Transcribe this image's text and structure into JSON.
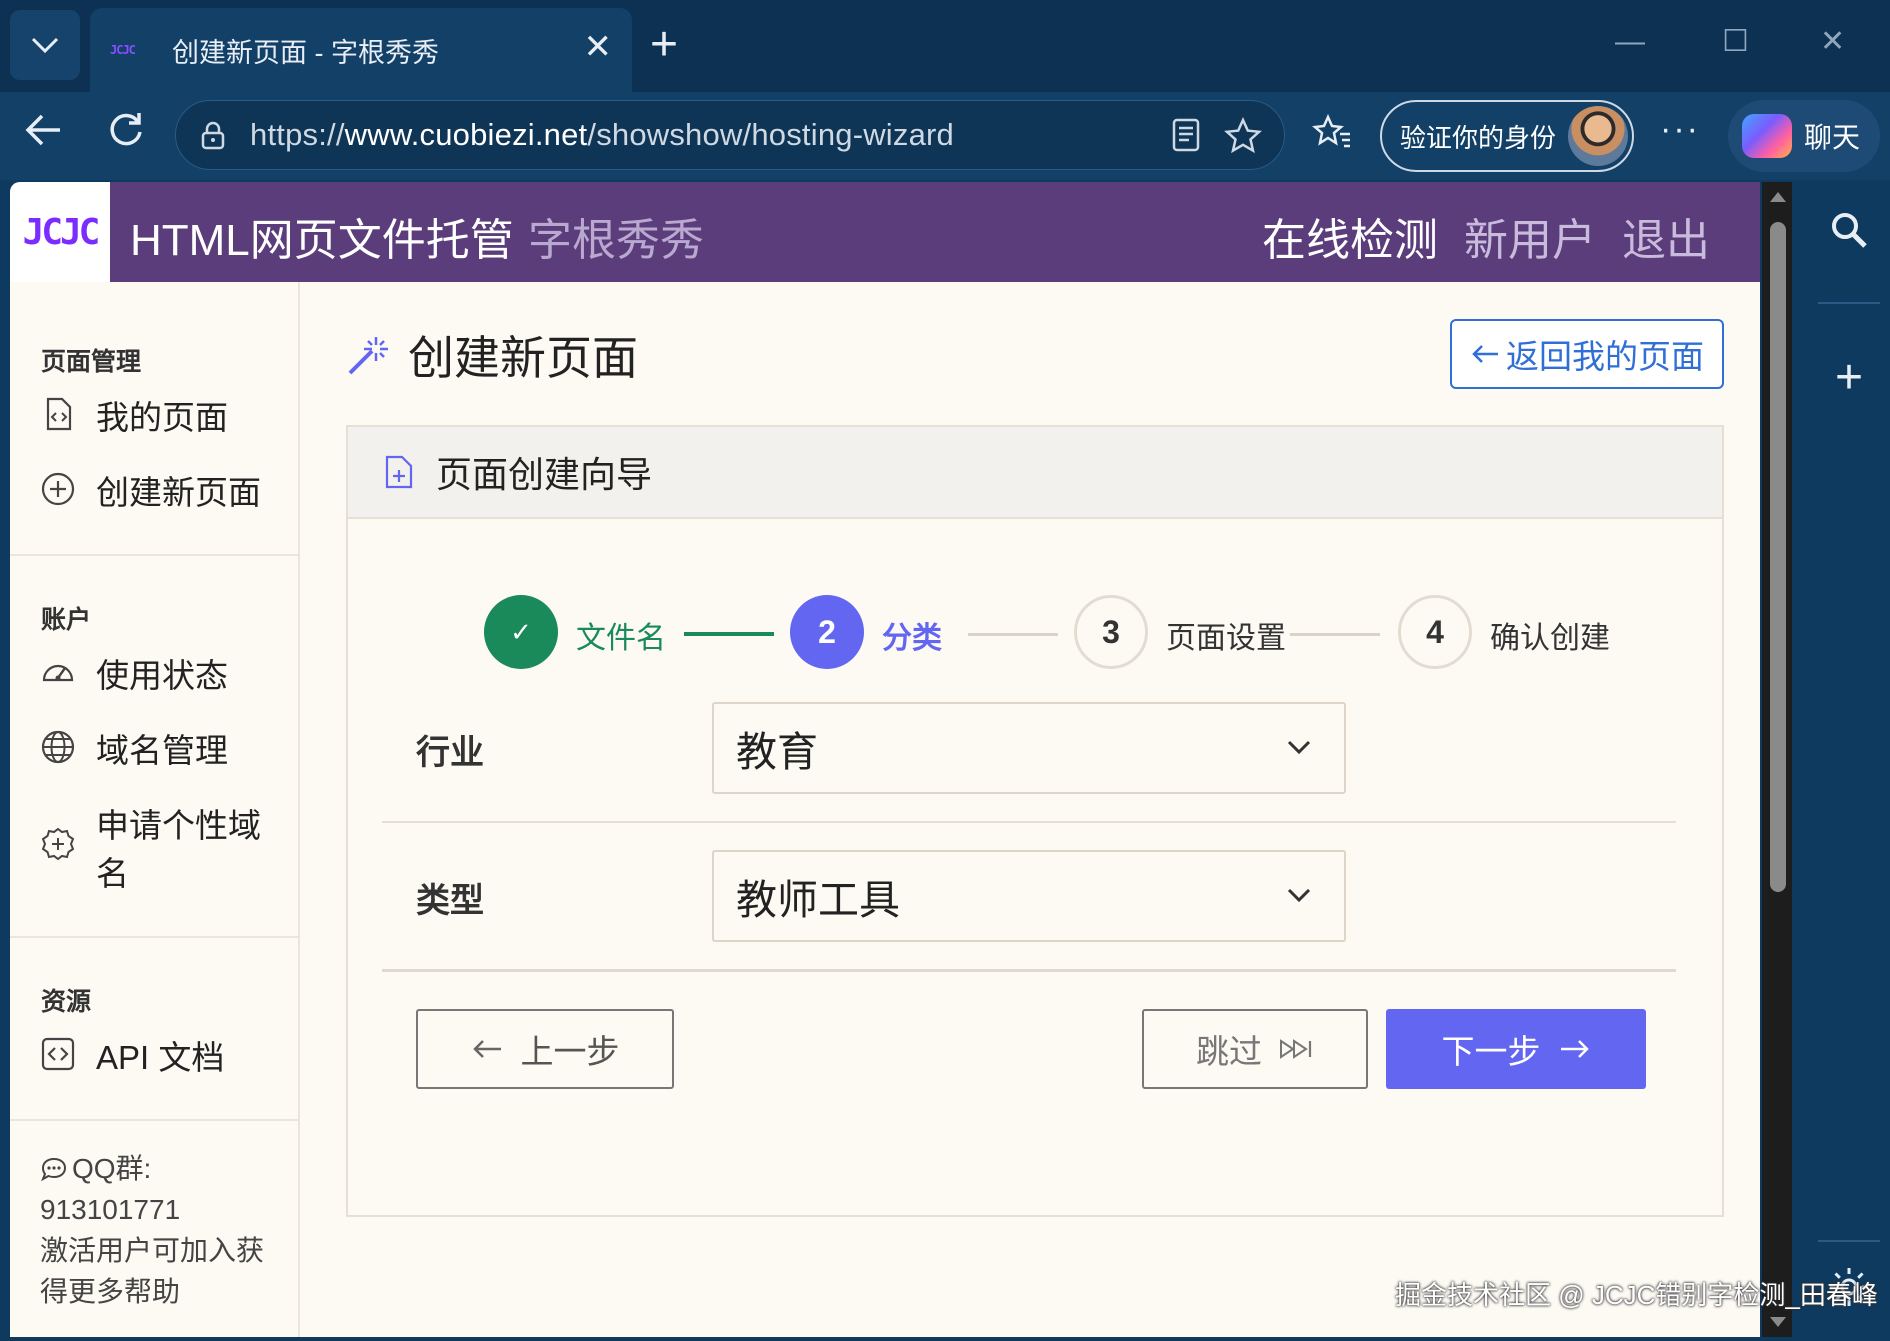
{
  "browser": {
    "tab_title": "创建新页面 - 字根秀秀",
    "tab_favicon": "JCJC",
    "url_scheme": "https://",
    "url_host": "www.cuobiezi.net",
    "url_path": "/showshow/hosting-wizard",
    "verify_label": "验证你的身份",
    "copilot_label": "聊天"
  },
  "site": {
    "logo": "JCJC",
    "title": "HTML网页文件托管",
    "subtitle": "字根秀秀",
    "nav": [
      "在线检测",
      "新用户",
      "退出"
    ],
    "accent": "#5a3d7a"
  },
  "sidebar": {
    "sections": [
      {
        "title": "页面管理",
        "items": [
          {
            "label": "我的页面",
            "icon": "file-code-icon"
          },
          {
            "label": "创建新页面",
            "icon": "plus-circle-icon"
          }
        ]
      },
      {
        "title": "账户",
        "items": [
          {
            "label": "使用状态",
            "icon": "speedometer-icon"
          },
          {
            "label": "域名管理",
            "icon": "globe-icon"
          },
          {
            "label": "申请个性域名",
            "icon": "badge-plus-icon"
          }
        ]
      },
      {
        "title": "资源",
        "items": [
          {
            "label": "API 文档",
            "icon": "code-square-icon"
          }
        ]
      }
    ],
    "footer": {
      "qq_label": "QQ群:",
      "qq_number": "913101771",
      "note": "激活用户可加入获得更多帮助"
    }
  },
  "main": {
    "heading": "创建新页面",
    "back_button": "返回我的页面",
    "card_title": "页面创建向导",
    "steps": [
      {
        "number": "✓",
        "label": "文件名",
        "state": "done"
      },
      {
        "number": "2",
        "label": "分类",
        "state": "active"
      },
      {
        "number": "3",
        "label": "页面设置",
        "state": "pending"
      },
      {
        "number": "4",
        "label": "确认创建",
        "state": "pending"
      }
    ],
    "fields": [
      {
        "label": "行业",
        "value": "教育"
      },
      {
        "label": "类型",
        "value": "教师工具"
      }
    ],
    "buttons": {
      "prev": "上一步",
      "skip": "跳过",
      "next": "下一步"
    },
    "colors": {
      "done": "#1a8a5a",
      "active": "#6366f1",
      "back_link": "#2f6fd6"
    }
  },
  "watermark": "掘金技术社区 @ JCJC错别字检测_田春峰"
}
